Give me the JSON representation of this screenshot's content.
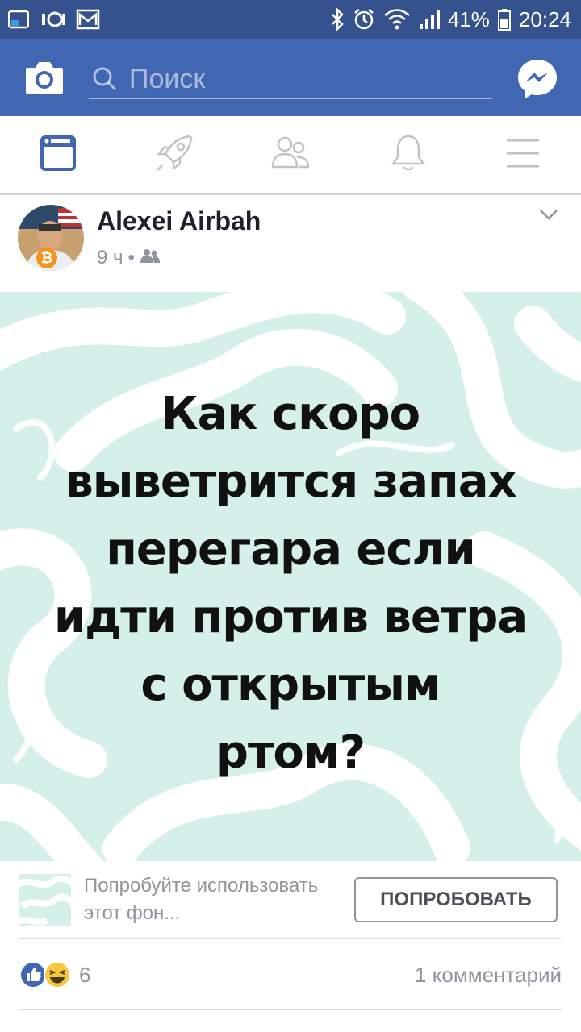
{
  "status_bar": {
    "battery": "41%",
    "time": "20:24"
  },
  "app_bar": {
    "search_placeholder": "Поиск"
  },
  "post": {
    "author": "Alexei Airbah",
    "time": "9 ч",
    "dot": "•",
    "text_lines": [
      "Как скоро",
      "выветрится запах",
      "перегара если",
      "идти против ветра",
      "с открытым",
      "ртом?"
    ],
    "background_color": "#d5f0e8",
    "swirl_color": "#ffffff"
  },
  "try_background": {
    "text": "Попробуйте использовать этот фон...",
    "button": "ПОПРОБОВАТЬ"
  },
  "reactions": {
    "count": "6",
    "comments": "1 комментарий"
  },
  "colors": {
    "status_bar": "#35528f",
    "app_bar": "#4267b2",
    "icon_gray": "#bec3c9"
  }
}
